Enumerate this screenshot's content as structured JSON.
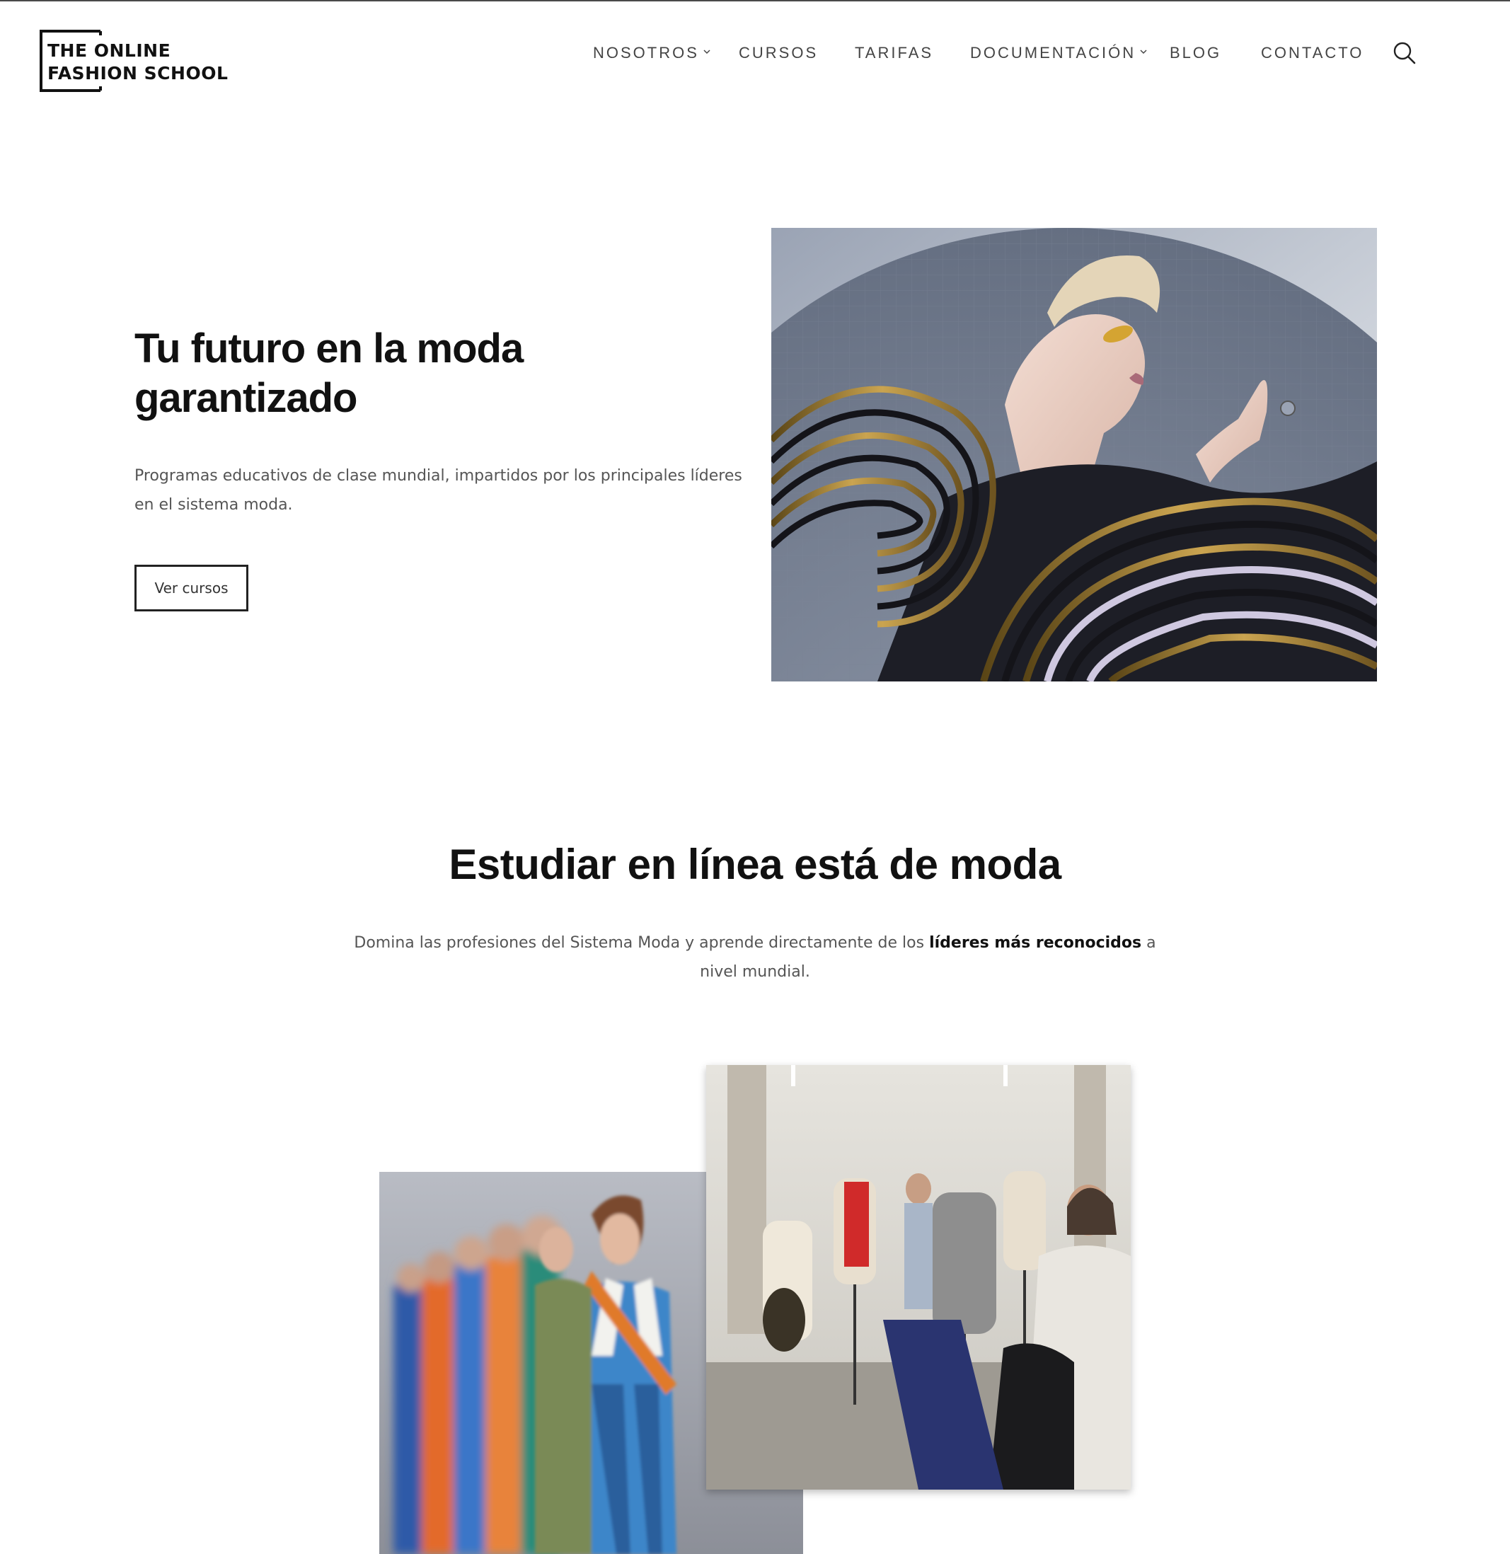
{
  "header": {
    "logo_line1": "THE ONLINE",
    "logo_line2": "FASHION SCHOOL",
    "nav": [
      {
        "label": "NOSOTROS",
        "has_dropdown": true
      },
      {
        "label": "CURSOS",
        "has_dropdown": false
      },
      {
        "label": "TARIFAS",
        "has_dropdown": false
      },
      {
        "label": "DOCUMENTACIÓN",
        "has_dropdown": true
      },
      {
        "label": "BLOG",
        "has_dropdown": false
      },
      {
        "label": "CONTACTO",
        "has_dropdown": false
      }
    ],
    "search_icon": "search-icon"
  },
  "hero": {
    "title_line1": "Tu futuro en la moda",
    "title_line2": "garantizado",
    "subtitle": "Programas educativos de clase mundial, impartidos por los principales líderes en el sistema moda.",
    "button_label": "Ver cursos"
  },
  "section": {
    "title": "Estudiar en línea está de moda",
    "subtitle_pre": "Domina las profesiones del Sistema Moda y aprende directamente de los ",
    "subtitle_bold": "líderes más reconocidos",
    "subtitle_post": " a nivel mundial."
  },
  "colors": {
    "text": "#111111",
    "muted": "#555555",
    "nav": "#444444",
    "border": "#222222"
  }
}
